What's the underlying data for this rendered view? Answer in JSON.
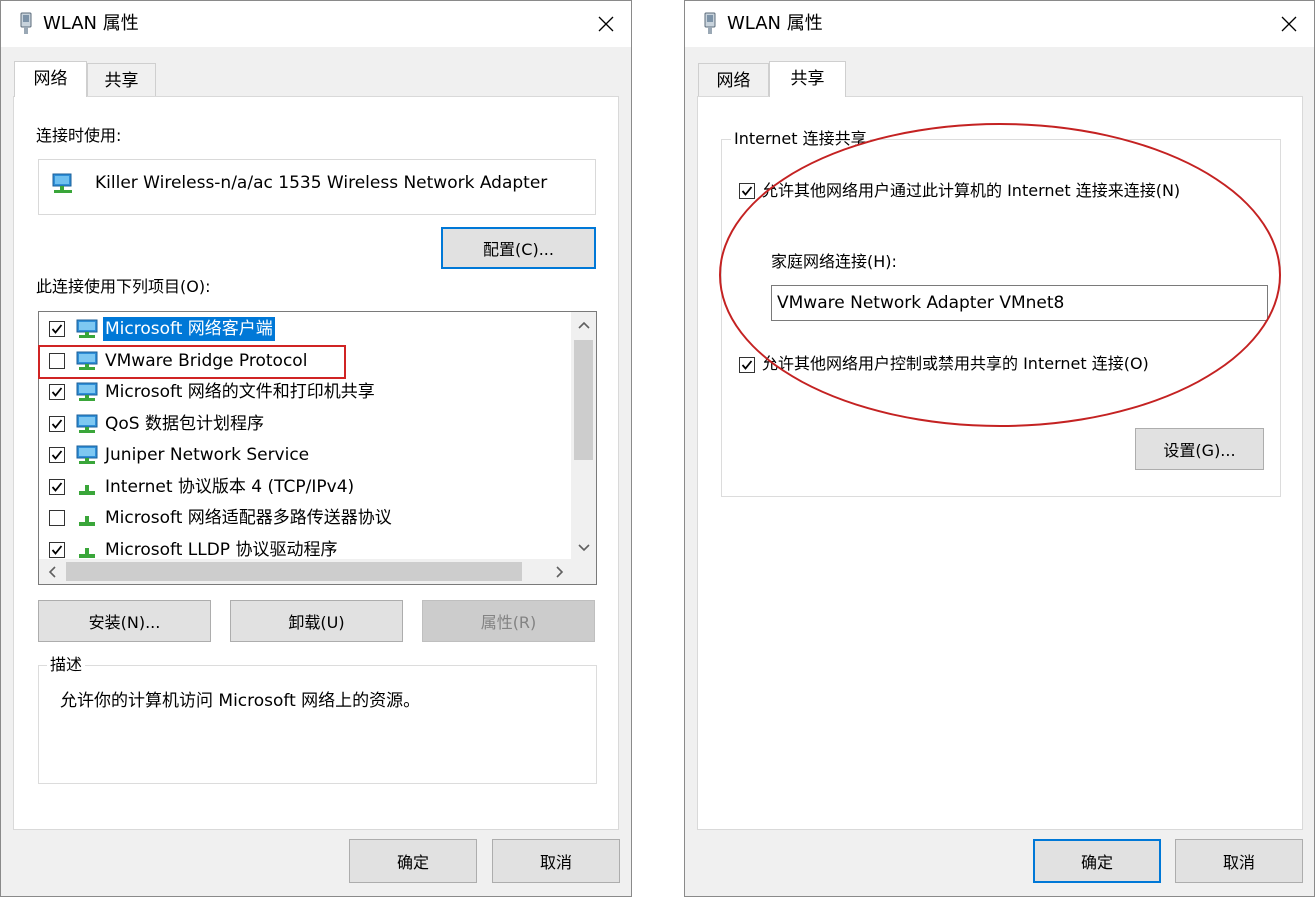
{
  "left_dialog": {
    "title": "WLAN 属性",
    "tabs": [
      {
        "label": "网络",
        "active": true
      },
      {
        "label": "共享",
        "active": false
      }
    ],
    "connect_using_label": "连接时使用:",
    "adapter_name": "Killer Wireless-n/a/ac 1535 Wireless Network Adapter",
    "configure_button": "配置(C)...",
    "items_label": "此连接使用下列项目(O):",
    "items": [
      {
        "label": "Microsoft 网络客户端",
        "checked": true,
        "selected": true,
        "icon": "network-client-icon"
      },
      {
        "label": "VMware Bridge Protocol",
        "checked": false,
        "selected": false,
        "icon": "network-protocol-icon"
      },
      {
        "label": "Microsoft 网络的文件和打印机共享",
        "checked": true,
        "selected": false,
        "icon": "network-service-icon"
      },
      {
        "label": "QoS 数据包计划程序",
        "checked": true,
        "selected": false,
        "icon": "network-service-icon"
      },
      {
        "label": "Juniper Network Service",
        "checked": true,
        "selected": false,
        "icon": "network-service-icon"
      },
      {
        "label": "Internet 协议版本 4 (TCP/IPv4)",
        "checked": true,
        "selected": false,
        "icon": "protocol-icon"
      },
      {
        "label": "Microsoft 网络适配器多路传送器协议",
        "checked": false,
        "selected": false,
        "icon": "protocol-icon"
      },
      {
        "label": "Microsoft LLDP 协议驱动程序",
        "checked": true,
        "selected": false,
        "icon": "protocol-icon"
      }
    ],
    "install_button": "安装(N)...",
    "uninstall_button": "卸载(U)",
    "properties_button": "属性(R)",
    "description_title": "描述",
    "description_text": "允许你的计算机访问 Microsoft 网络上的资源。",
    "ok_button": "确定",
    "cancel_button": "取消"
  },
  "right_dialog": {
    "title": "WLAN 属性",
    "tabs": [
      {
        "label": "网络",
        "active": false
      },
      {
        "label": "共享",
        "active": true
      }
    ],
    "group_title": "Internet 连接共享",
    "allow_connect_label": "允许其他网络用户通过此计算机的 Internet 连接来连接(N)",
    "allow_connect_checked": true,
    "home_network_label": "家庭网络连接(H):",
    "home_network_value": "VMware Network Adapter VMnet8",
    "allow_control_label": "允许其他网络用户控制或禁用共享的 Internet 连接(O)",
    "allow_control_checked": true,
    "settings_button": "设置(G)...",
    "ok_button": "确定",
    "cancel_button": "取消"
  },
  "colors": {
    "selection": "#0078d7",
    "annotation_red": "#d02424",
    "dialog_bg": "#f0f0f0"
  }
}
